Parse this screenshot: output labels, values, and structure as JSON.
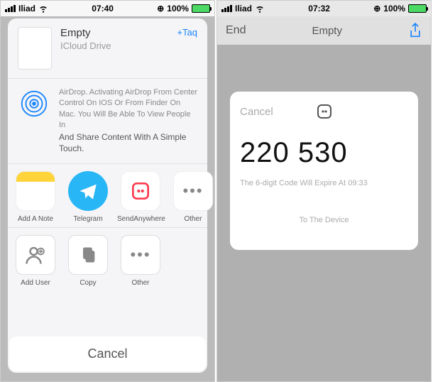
{
  "left": {
    "status": {
      "carrier": "Iliad",
      "time": "07:40",
      "battery_pct": "100%"
    },
    "header": {
      "title": "Empty",
      "subtitle": "ICloud Drive",
      "tag": "+Taq"
    },
    "airdrop": {
      "text": "AirDrop. Activating AirDrop From Center Control On IOS Or From Finder On Mac. You Will Be Able To View People In",
      "bold": "And Share Content With A Simple Touch."
    },
    "apps": {
      "notes": "Add A Note",
      "telegram": "Telegram",
      "sendanywhere": "SendAnywhere",
      "other": "Other"
    },
    "actions": {
      "adduser": "Add User",
      "copy": "Copy",
      "other": "Other"
    },
    "cancel": "Cancel"
  },
  "right": {
    "status": {
      "carrier": "Iliad",
      "time": "07:32",
      "battery_pct": "100%"
    },
    "nav": {
      "end": "End",
      "title": "Empty"
    },
    "modal": {
      "cancel": "Cancel",
      "code": "220 530",
      "expire": "The 6-digit Code Will Expire At 09:33",
      "todevice": "To The Device"
    }
  }
}
